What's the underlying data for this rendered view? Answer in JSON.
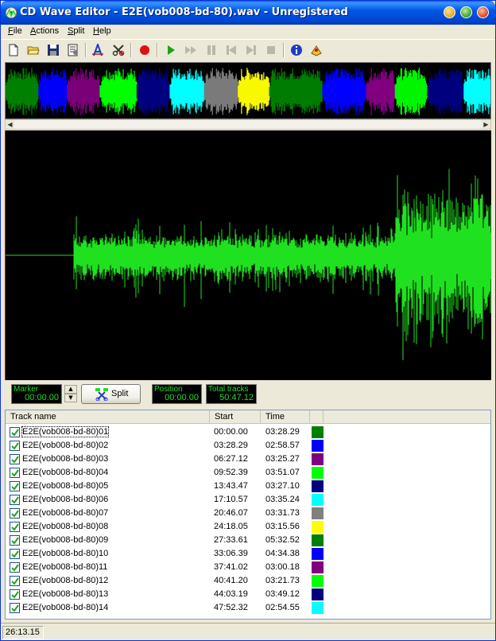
{
  "window": {
    "title": "CD Wave Editor - E2E(vob008-bd-80).wav - Unregistered"
  },
  "menu": [
    "File",
    "Actions",
    "Split",
    "Help"
  ],
  "toolbar": [
    "new-icon",
    "open-icon",
    "save-icon",
    "properties-icon",
    "autosplit-icon",
    "split-marker-icon",
    "record-icon",
    "play-icon",
    "fast-forward-icon",
    "pause-icon",
    "prev-track-icon",
    "next-track-icon",
    "stop-icon",
    "info-icon",
    "help-book-icon"
  ],
  "colors": {
    "wave": "#1FE11F",
    "tracks": [
      "#008000",
      "#0000FF",
      "#800080",
      "#00FF00",
      "#000080",
      "#00FFFF",
      "#808080",
      "#FFFF00",
      "#008000",
      "#0000FF",
      "#800080",
      "#00FF00",
      "#000080",
      "#00FFFF"
    ]
  },
  "controls": {
    "marker_label": "Marker",
    "marker_value": "00:00.00",
    "split_label": "Split",
    "position_label": "Position",
    "position_value": "00:00.00",
    "total_label": "Total tracks",
    "total_value": "50:47.12"
  },
  "tracklist": {
    "headers": [
      "Track name",
      "Start",
      "Time"
    ],
    "rows": [
      {
        "name": "E2E(vob008-bd-80)01",
        "start": "00:00.00",
        "time": "03:28.29"
      },
      {
        "name": "E2E(vob008-bd-80)02",
        "start": "03:28.29",
        "time": "02:58.57"
      },
      {
        "name": "E2E(vob008-bd-80)03",
        "start": "06:27.12",
        "time": "03:25.27"
      },
      {
        "name": "E2E(vob008-bd-80)04",
        "start": "09:52.39",
        "time": "03:51.07"
      },
      {
        "name": "E2E(vob008-bd-80)05",
        "start": "13:43.47",
        "time": "03:27.10"
      },
      {
        "name": "E2E(vob008-bd-80)06",
        "start": "17:10.57",
        "time": "03:35.24"
      },
      {
        "name": "E2E(vob008-bd-80)07",
        "start": "20:46.07",
        "time": "03:31.73"
      },
      {
        "name": "E2E(vob008-bd-80)08",
        "start": "24:18.05",
        "time": "03:15.56"
      },
      {
        "name": "E2E(vob008-bd-80)09",
        "start": "27:33.61",
        "time": "05:32.52"
      },
      {
        "name": "E2E(vob008-bd-80)10",
        "start": "33:06.39",
        "time": "04:34.38"
      },
      {
        "name": "E2E(vob008-bd-80)11",
        "start": "37:41.02",
        "time": "03:00.18"
      },
      {
        "name": "E2E(vob008-bd-80)12",
        "start": "40:41.20",
        "time": "03:21.73"
      },
      {
        "name": "E2E(vob008-bd-80)13",
        "start": "44:03.19",
        "time": "03:49.12"
      },
      {
        "name": "E2E(vob008-bd-80)14",
        "start": "47:52.32",
        "time": "02:54.55"
      }
    ]
  },
  "status": {
    "time": "26:13.15"
  }
}
